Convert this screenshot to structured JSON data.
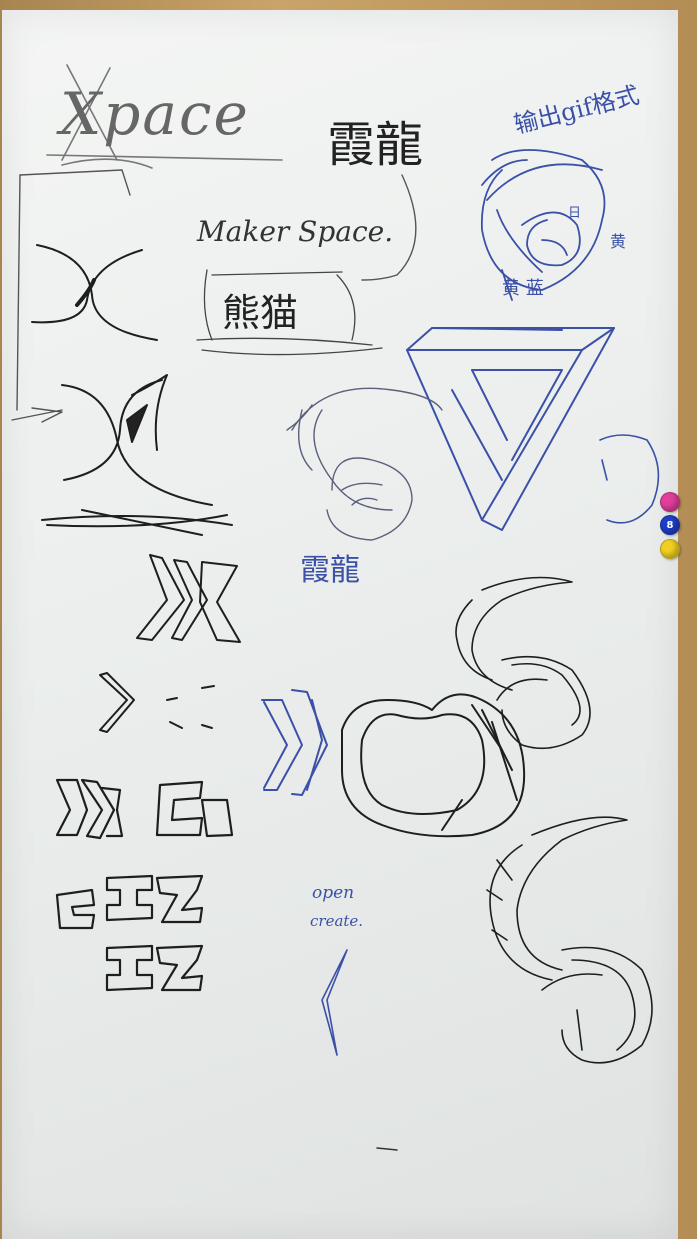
{
  "whiteboard": {
    "title": "Xpace",
    "chinese_title": "霞龍",
    "subtitle": "Maker Space.",
    "boxed_text": "熊猫",
    "gif_note": "输出gif格式",
    "color_note_yellow": "黄",
    "color_note_yellow2": "黄 蓝",
    "sun_mark": "日",
    "small_chinese": "霞龍",
    "open_text": "open",
    "create_text": "create."
  },
  "magnets": [
    {
      "name": "pink-magnet",
      "color": "#e23e9c",
      "label": ""
    },
    {
      "name": "blue-magnet",
      "color": "#1f3fc9",
      "label": "8"
    },
    {
      "name": "yellow-magnet",
      "color": "#f0d020",
      "label": ""
    }
  ],
  "colors": {
    "ink_black": "#1e1e1e",
    "ink_blue": "#3b50a8",
    "board": "#eceeed",
    "frame": "#b8955c"
  }
}
